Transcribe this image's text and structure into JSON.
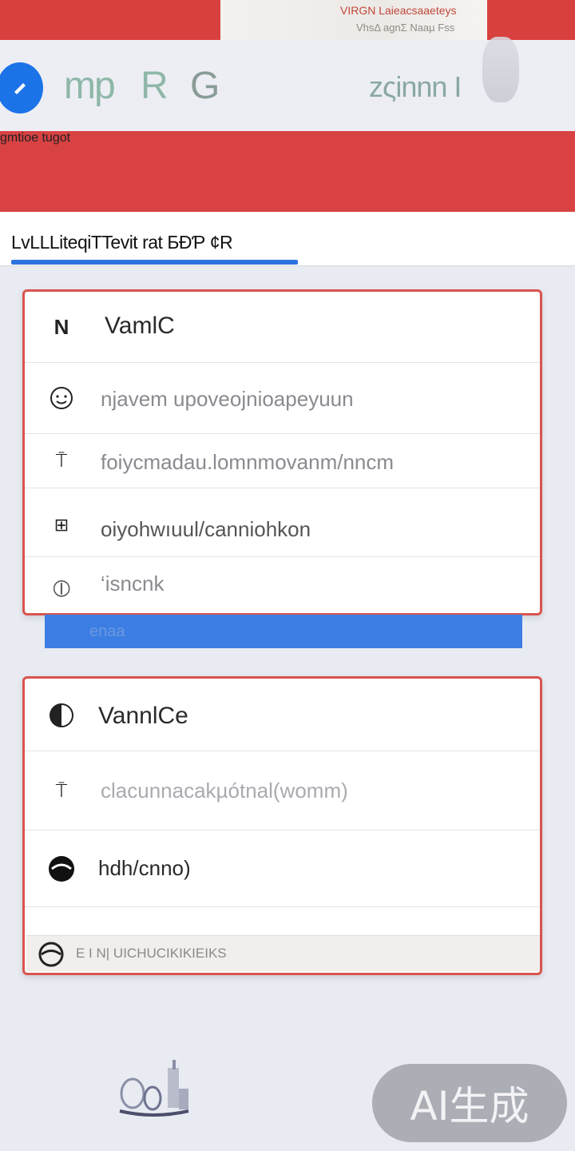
{
  "banner": {
    "line1": "VIRGN Laieacsaaeteys",
    "line2": "VhsΔ agnΣ Naaµ Fss"
  },
  "toolbar": {
    "glyph_a": "mp",
    "glyph_b": "R",
    "glyph_c": "G",
    "right_text": "zςinnn I"
  },
  "header": {
    "title": "gmtioe tugot"
  },
  "tab": {
    "label": "LvLLLiteqiTTevit rat БƉƤ ¢R"
  },
  "card1": {
    "head": "VamlC",
    "head_icon_label": "N",
    "rows": [
      {
        "text": "njavem   upoveojnioapeyuun"
      },
      {
        "text": "foiycmadau.lomnmovanm/nncm"
      },
      {
        "text": "oiyohwıuul/canniohkon"
      },
      {
        "text": "‘isncnk"
      }
    ]
  },
  "blue_strip": {
    "text": "enaa"
  },
  "card2": {
    "head": "VannlCe",
    "rows": [
      {
        "text": "clacunnacakµótnal(womm)"
      },
      {
        "text": "hdh/cnno)"
      }
    ]
  },
  "footer": {
    "text": "E  I N| UICHUCIKIKIEIKS"
  },
  "watermark": {
    "text": "AI生成"
  },
  "colors": {
    "brand_red": "#d84243",
    "accent_blue": "#1c73e8",
    "card_border": "#d9544f"
  }
}
